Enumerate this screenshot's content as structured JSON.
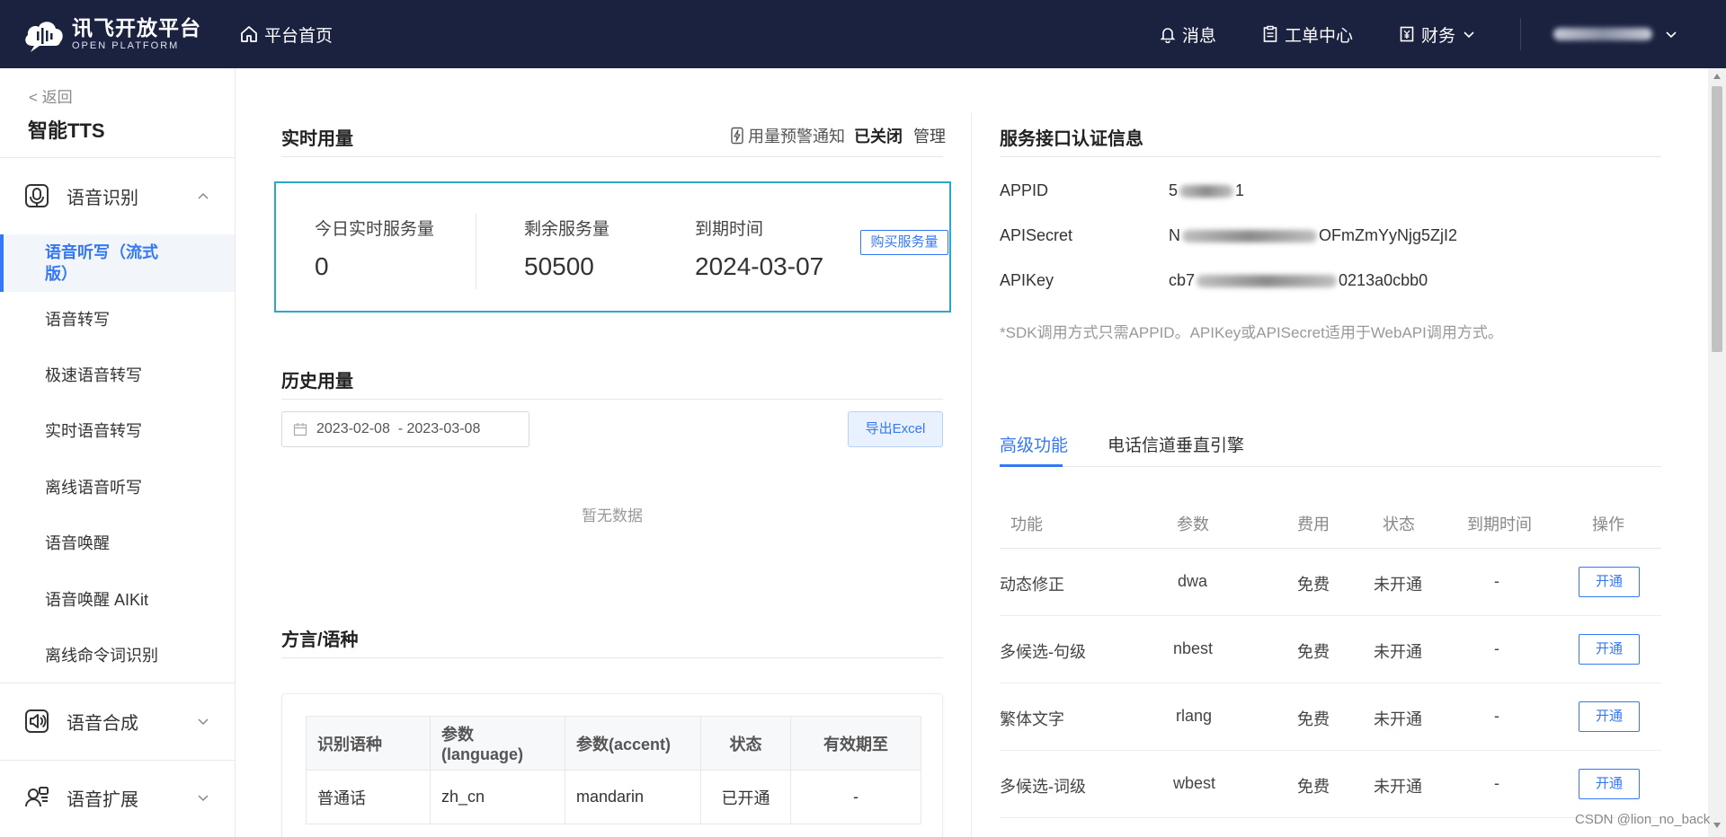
{
  "header": {
    "logo_cn": "讯飞开放平台",
    "logo_en": "OPEN PLATFORM",
    "home": "平台首页",
    "messages": "消息",
    "tickets": "工单中心",
    "finance": "财务"
  },
  "sidebar": {
    "back": "< 返回",
    "product": "智能TTS",
    "groups": [
      {
        "label": "语音识别"
      },
      {
        "label": "语音合成"
      },
      {
        "label": "语音扩展"
      }
    ],
    "items": [
      {
        "label": "语音听写（流式版）"
      },
      {
        "label": "语音转写"
      },
      {
        "label": "极速语音转写"
      },
      {
        "label": "实时语音转写"
      },
      {
        "label": "离线语音听写"
      },
      {
        "label": "语音唤醒"
      },
      {
        "label": "语音唤醒 AIKit"
      },
      {
        "label": "离线命令词识别"
      }
    ]
  },
  "realtime": {
    "title": "实时用量",
    "alert_label": "用量预警通知",
    "alert_status": "已关闭",
    "manage": "管理",
    "today_label": "今日实时服务量",
    "today_value": "0",
    "remain_label": "剩余服务量",
    "remain_value": "50500",
    "expire_label": "到期时间",
    "expire_value": "2024-03-07",
    "buy": "购买服务量"
  },
  "history": {
    "title": "历史用量",
    "date_range": "2023-02-08  - 2023-03-08",
    "export": "导出Excel",
    "empty": "暂无数据"
  },
  "dialect": {
    "title": "方言/语种",
    "headers": [
      "识别语种",
      "参数(language)",
      "参数(accent)",
      "状态",
      "有效期至"
    ],
    "rows": [
      [
        "普通话",
        "zh_cn",
        "mandarin",
        "已开通",
        "-"
      ]
    ]
  },
  "credentials": {
    "title": "服务接口认证信息",
    "appid_label": "APPID",
    "appid_pre": "5",
    "appid_post": "1",
    "secret_label": "APISecret",
    "secret_pre": "N",
    "secret_post": "OFmZmYyNjg5ZjI2",
    "key_label": "APIKey",
    "key_pre": "cb7",
    "key_post": "0213a0cbb0",
    "note": "*SDK调用方式只需APPID。APIKey或APISecret适用于WebAPI调用方式。"
  },
  "tabs": [
    "高级功能",
    "电话信道垂直引擎"
  ],
  "features": {
    "headers": [
      "功能",
      "参数",
      "费用",
      "状态",
      "到期时间",
      "操作"
    ],
    "rows": [
      {
        "name": "动态修正",
        "param": "dwa",
        "fee": "免费",
        "status": "未开通",
        "expire": "-",
        "action": "开通"
      },
      {
        "name": "多候选-句级",
        "param": "nbest",
        "fee": "免费",
        "status": "未开通",
        "expire": "-",
        "action": "开通"
      },
      {
        "name": "繁体文字",
        "param": "rlang",
        "fee": "免费",
        "status": "未开通",
        "expire": "-",
        "action": "开通"
      },
      {
        "name": "多候选-词级",
        "param": "wbest",
        "fee": "免费",
        "status": "未开通",
        "expire": "-",
        "action": "开通"
      }
    ]
  },
  "watermark": "CSDN @lion_no_back",
  "colors": {
    "topbar": "#1b2240",
    "accent": "#3478f6",
    "usage_border": "#2ca7c9"
  }
}
